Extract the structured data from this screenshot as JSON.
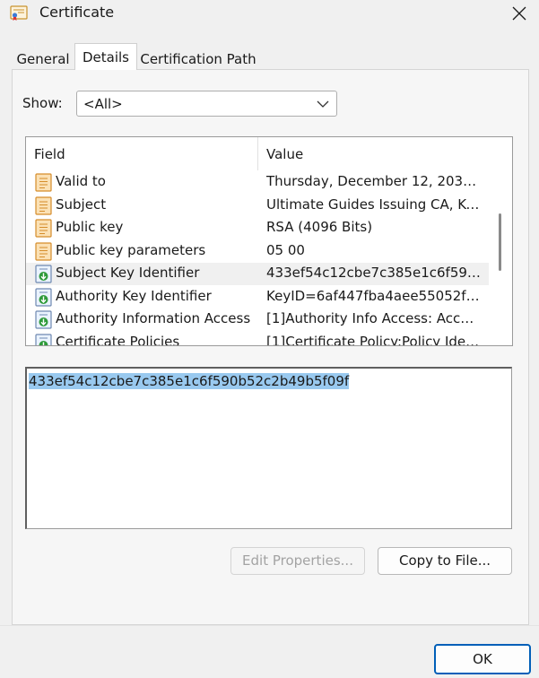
{
  "window": {
    "title": "Certificate"
  },
  "tabs": [
    {
      "label": "General"
    },
    {
      "label": "Details"
    },
    {
      "label": "Certification Path"
    }
  ],
  "show": {
    "label": "Show:",
    "selected": "<All>"
  },
  "fields_list": {
    "columns": {
      "field": "Field",
      "value": "Value"
    },
    "rows": [
      {
        "field": "Valid to",
        "value": "Thursday, December 12, 2030…",
        "icon": "certificate-field-icon"
      },
      {
        "field": "Subject",
        "value": "Ultimate Guides Issuing CA, Ke…",
        "icon": "certificate-field-icon"
      },
      {
        "field": "Public key",
        "value": "RSA (4096 Bits)",
        "icon": "certificate-field-icon"
      },
      {
        "field": "Public key parameters",
        "value": "05 00",
        "icon": "certificate-field-icon"
      },
      {
        "field": "Subject Key Identifier",
        "value": "433ef54c12cbe7c385e1c6f59…",
        "icon": "certificate-extension-icon",
        "selected": true
      },
      {
        "field": "Authority Key Identifier",
        "value": "KeyID=6af447fba4aee55052f…",
        "icon": "certificate-extension-icon"
      },
      {
        "field": "Authority Information Access",
        "value": "[1]Authority Info Access: Acc…",
        "icon": "certificate-extension-icon"
      },
      {
        "field": "Certificate Policies",
        "value": "[1]Certificate Policy:Policy Ide…",
        "icon": "certificate-extension-icon"
      }
    ]
  },
  "value_box": {
    "text": "433ef54c12cbe7c385e1c6f590b52c2b49b5f09f"
  },
  "buttons": {
    "edit_properties": "Edit Properties...",
    "copy_to_file": "Copy to File...",
    "ok": "OK"
  },
  "colors": {
    "selection_highlight": "#99c9ef",
    "accent": "#005fb8",
    "icon_orange": "#e8a040",
    "icon_green": "#2e9a3a"
  }
}
